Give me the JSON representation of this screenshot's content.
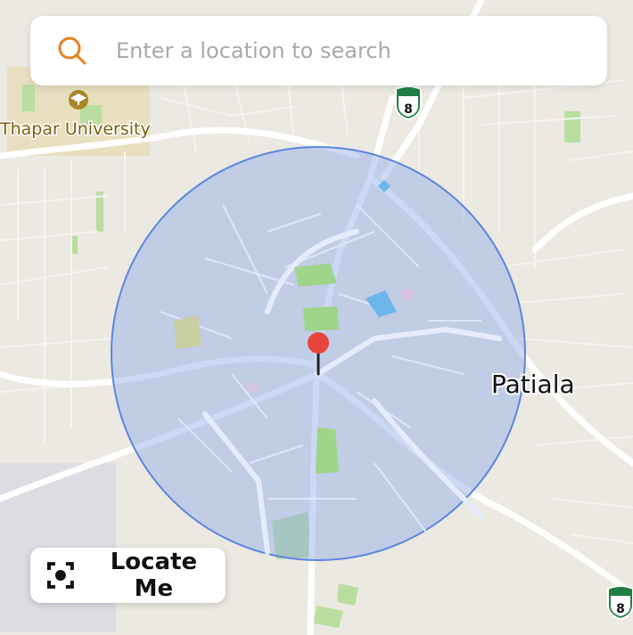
{
  "search": {
    "placeholder": "Enter a location to search",
    "icon": "search-icon",
    "icon_color": "#e8821e"
  },
  "map": {
    "labels": {
      "university": "Thapar University",
      "city": "Patiala"
    },
    "highway_shields": [
      "8",
      "8"
    ],
    "radius_circle": {
      "fill": "#8fa8e8",
      "stroke": "#5c85e0"
    },
    "marker": {
      "icon": "map-pin-icon",
      "color": "#e8453c"
    }
  },
  "locate_button": {
    "label": "Locate Me",
    "icon": "crosshair-focus-icon"
  }
}
